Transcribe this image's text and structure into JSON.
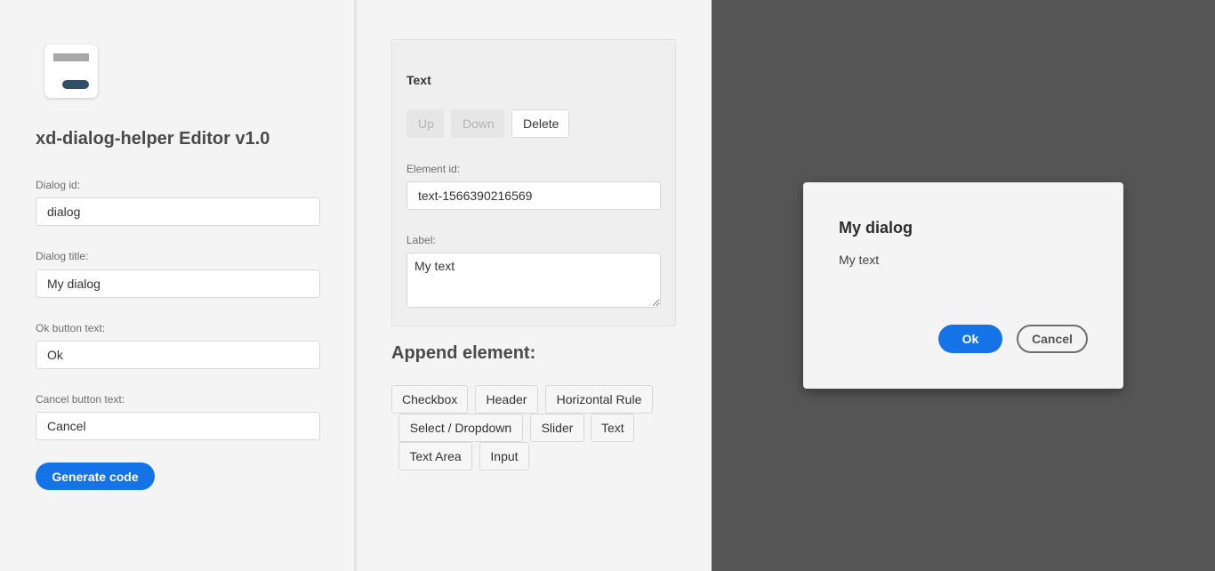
{
  "editor": {
    "title": "xd-dialog-helper Editor v1.0",
    "fields": {
      "dialog_id": {
        "label": "Dialog id:",
        "value": "dialog"
      },
      "dialog_title": {
        "label": "Dialog title:",
        "value": "My dialog"
      },
      "ok_text": {
        "label": "Ok button text:",
        "value": "Ok"
      },
      "cancel_text": {
        "label": "Cancel button text:",
        "value": "Cancel"
      }
    },
    "generate_label": "Generate code"
  },
  "element_editor": {
    "type_label": "Text",
    "up_label": "Up",
    "down_label": "Down",
    "delete_label": "Delete",
    "element_id": {
      "label": "Element id:",
      "value": "text-1566390216569"
    },
    "label_field": {
      "label": "Label:",
      "value": "My text"
    }
  },
  "append": {
    "title": "Append element:",
    "buttons": [
      "Checkbox",
      "Header",
      "Horizontal Rule",
      "Select / Dropdown",
      "Slider",
      "Text",
      "Text Area",
      "Input"
    ]
  },
  "preview": {
    "title": "My dialog",
    "text": "My text",
    "ok_label": "Ok",
    "cancel_label": "Cancel"
  },
  "colors": {
    "accent": "#1473e6",
    "preview_background": "#555555",
    "panel_background": "#f4f4f4"
  }
}
